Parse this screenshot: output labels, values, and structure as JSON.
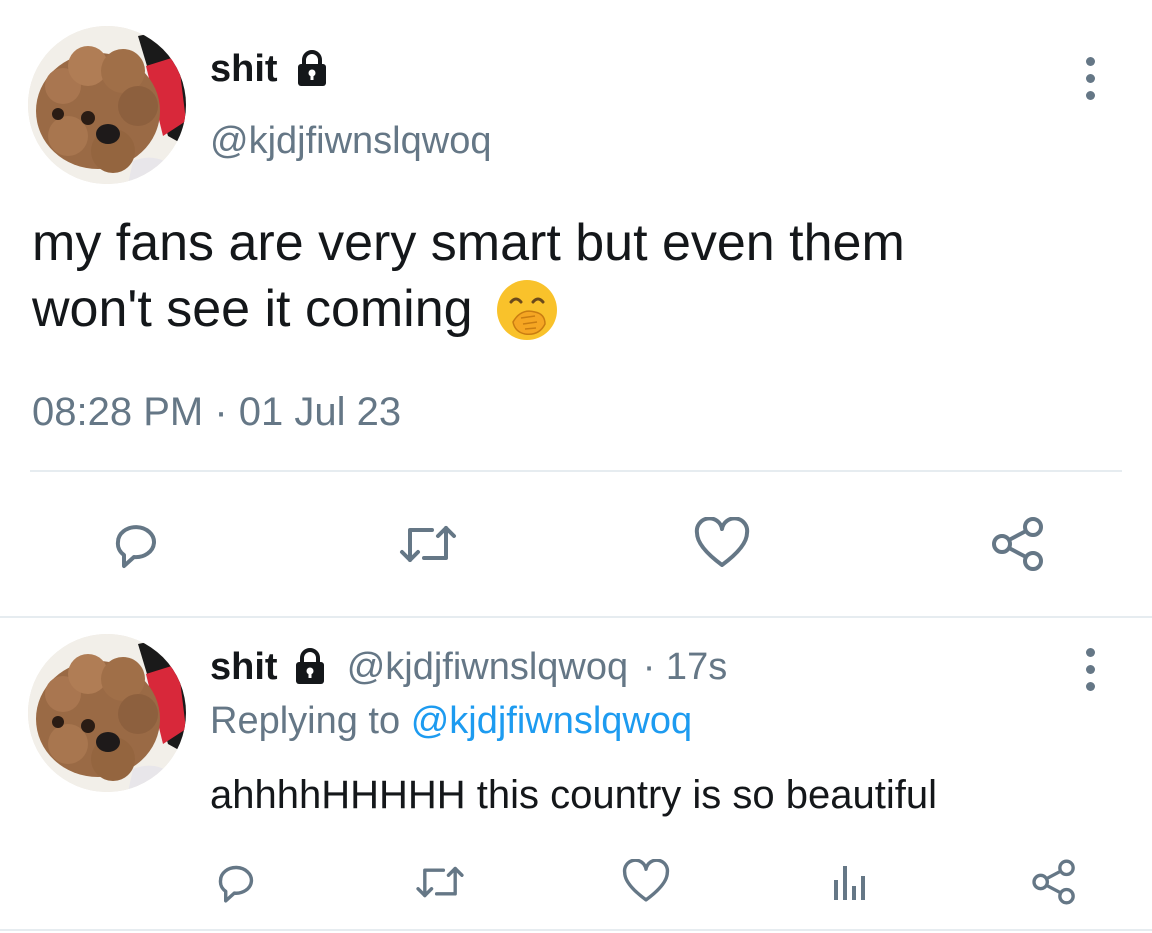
{
  "main_tweet": {
    "display_name": "shit",
    "handle": "@kjdjfiwnslqwoq",
    "text_line1": "my fans are very smart but even them",
    "text_line2": "won't see it coming",
    "emoji": "🤭",
    "timestamp": "08:28 PM · 01 Jul 23"
  },
  "reply_tweet": {
    "display_name": "shit",
    "handle": "@kjdjfiwnslqwoq",
    "age": "· 17s",
    "replying_prefix": "Replying to",
    "replying_handle": "@kjdjfiwnslqwoq",
    "text": "ahhhhHHHHH this country is so beautiful"
  },
  "icons": {
    "lock": "lock-icon",
    "more": "more-vertical-icon",
    "reply": "reply-icon",
    "retweet": "retweet-icon",
    "like": "heart-icon",
    "share": "share-icon",
    "analytics": "analytics-icon"
  },
  "colors": {
    "text": "#14171a",
    "muted": "#657786",
    "link": "#1d9bf0",
    "divider": "#e6ecf0"
  }
}
